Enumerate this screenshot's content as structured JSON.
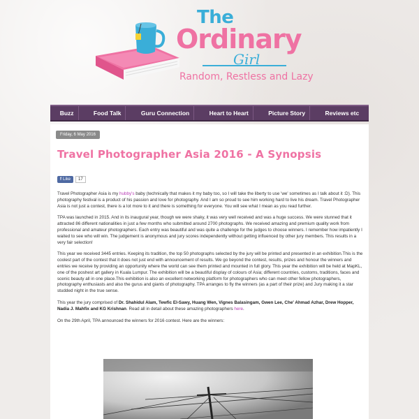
{
  "blog": {
    "title_the": "The",
    "title_main": "Ordinary",
    "title_girl": "Girl",
    "tagline": "Random, Restless and Lazy"
  },
  "nav": {
    "items": [
      {
        "label": "Buzz"
      },
      {
        "label": "Food Talk"
      },
      {
        "label": "Guru Connection"
      },
      {
        "label": "Heart to Heart"
      },
      {
        "label": "Picture Story"
      },
      {
        "label": "Reviews etc"
      }
    ]
  },
  "post": {
    "date": "Friday, 6 May 2016",
    "title": "Travel Photographer Asia 2016 - A Synopsis",
    "like_label": "Like",
    "like_count": "17",
    "p1_a": "Travel Photographer Asia is my ",
    "p1_link": "hubby's",
    "p1_b": " baby (technically that makes it my baby too, so I will take the liberty to use 'we' sometimes as I talk about it :D). This photography festival is a product of his passion and love for photography. And I am so proud to see him working hard to live his dream. Travel Photographer Asia is not just a contest, there is a lot more to it and there is something for everyone. You will see what I mean as you read further.",
    "p2": "TPA was launched in 2015. And in its inaugural year, though we were shaky, it was very well received and was a huge success. We were stunned that it attracted 86 different nationalities in just a few months who submitted around 2700 photographs. We received amazing and premium quality work from professional and amateur photographers. Each entry was beautiful and was quite a challenge for the judges to choose winners. I remember how impatiently I waited to see who will win. The judgement is anonymous and jury scores independently without getting influenced by other jury members. This results in a very fair selection!",
    "p3": "This year we received 3445 entries. Keeping its tradition, the top 50 photographs selected by the jury will be printed and presented in an exhibition.This is the coolest part of the contest that it does not just end with announcement of results. We go beyond the contest, results, prizes and honour the winners and entries we receive by providing an opportunity where the world can see them printed and mounted in full glory. This year the exhibition will be held at MapKL, one of the poshest art gallery in Kuala Lumpur. The exhibition will be a beautiful display of colours of Asia; different countries, customs, traditions, faces and scenic beauty all in one place.This exhibition is also an excellent networking platform for photographers who can meet other fellow photographers, photography enthusiasts and also the gurus and giants of photography. TPA arranges to fly the winners (as a part of their prize) and Jury making it a star studded night in the true sense.",
    "p4_a": "This year the jury comprised of ",
    "p4_jury": "Dr. Shahidul Alam, Tewfic El-Sawy, Huang Wen, Vignes Balasingam, Gwen Lee, Che' Ahmad Azhar, Drew Hopper, Nadia J. Mahfix and KG Krishnan",
    "p4_b": ". Read all in detail about these amazing photographers ",
    "p4_link": "here",
    "p4_c": ".",
    "p5": "On the 29th April, TPA announced the winners for 2016 contest. Here are the winners:"
  },
  "colors": {
    "brand_pink": "#ef72a3",
    "brand_blue": "#3aaed8",
    "nav_bg": "#5b3d63",
    "link": "#b83bb5"
  }
}
